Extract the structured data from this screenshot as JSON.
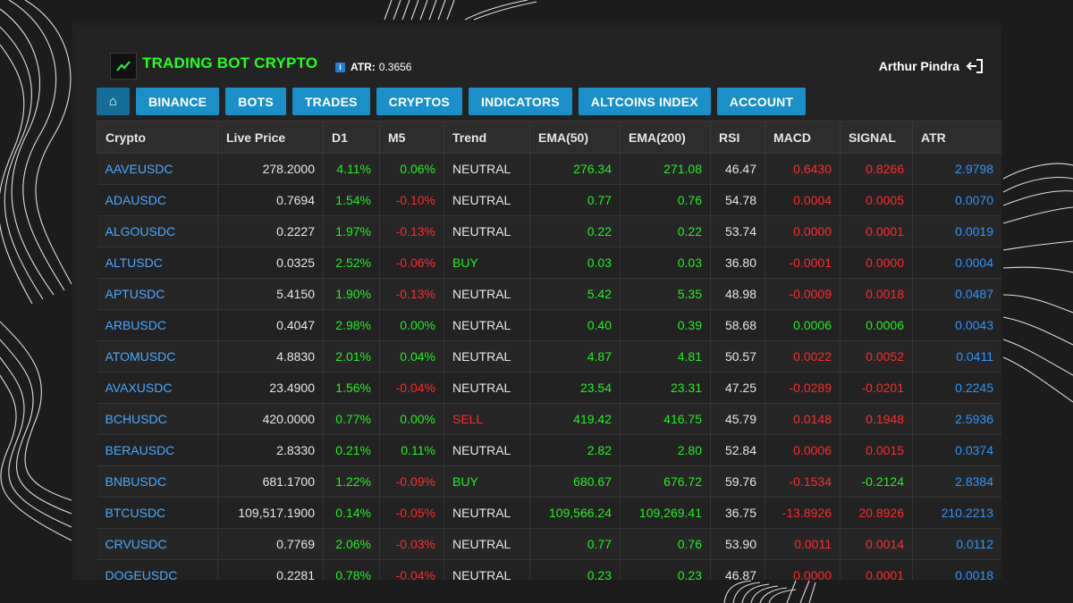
{
  "app": {
    "title": "TRADING BOT CRYPTO",
    "atr_label": "ATR:",
    "atr_value": "0.3656",
    "user_name": "Arthur Pindra"
  },
  "nav": {
    "home": "⌂",
    "items": [
      "BINANCE",
      "BOTS",
      "TRADES",
      "CRYPTOS",
      "INDICATORS",
      "ALTCOINS INDEX",
      "ACCOUNT"
    ]
  },
  "colors": {
    "accent": "#1b8fc7",
    "title": "#22ff22",
    "positive": "#22ee22",
    "negative": "#ff2a2a",
    "link": "#4aa8ff"
  },
  "table": {
    "headers": [
      "Crypto",
      "Live Price",
      "D1",
      "M5",
      "Trend",
      "EMA(50)",
      "EMA(200)",
      "RSI",
      "MACD",
      "SIGNAL",
      "ATR"
    ],
    "rows": [
      {
        "crypto": "AAVEUSDC",
        "price": "278.2000",
        "d1": "4.11%",
        "m5": "0.06%",
        "trend": "NEUTRAL",
        "ema50": "276.34",
        "ema200": "271.08",
        "rsi": "46.47",
        "macd": "0.6430",
        "signal": "0.8266",
        "atr": "2.9798"
      },
      {
        "crypto": "ADAUSDC",
        "price": "0.7694",
        "d1": "1.54%",
        "m5": "-0.10%",
        "trend": "NEUTRAL",
        "ema50": "0.77",
        "ema200": "0.76",
        "rsi": "54.78",
        "macd": "0.0004",
        "signal": "0.0005",
        "atr": "0.0070"
      },
      {
        "crypto": "ALGOUSDC",
        "price": "0.2227",
        "d1": "1.97%",
        "m5": "-0.13%",
        "trend": "NEUTRAL",
        "ema50": "0.22",
        "ema200": "0.22",
        "rsi": "53.74",
        "macd": "0.0000",
        "signal": "0.0001",
        "atr": "0.0019"
      },
      {
        "crypto": "ALTUSDC",
        "price": "0.0325",
        "d1": "2.52%",
        "m5": "-0.06%",
        "trend": "BUY",
        "ema50": "0.03",
        "ema200": "0.03",
        "rsi": "36.80",
        "macd": "-0.0001",
        "signal": "0.0000",
        "atr": "0.0004"
      },
      {
        "crypto": "APTUSDC",
        "price": "5.4150",
        "d1": "1.90%",
        "m5": "-0.13%",
        "trend": "NEUTRAL",
        "ema50": "5.42",
        "ema200": "5.35",
        "rsi": "48.98",
        "macd": "-0.0009",
        "signal": "0.0018",
        "atr": "0.0487"
      },
      {
        "crypto": "ARBUSDC",
        "price": "0.4047",
        "d1": "2.98%",
        "m5": "0.00%",
        "trend": "NEUTRAL",
        "ema50": "0.40",
        "ema200": "0.39",
        "rsi": "58.68",
        "macd": "0.0006",
        "signal": "0.0006",
        "atr": "0.0043"
      },
      {
        "crypto": "ATOMUSDC",
        "price": "4.8830",
        "d1": "2.01%",
        "m5": "0.04%",
        "trend": "NEUTRAL",
        "ema50": "4.87",
        "ema200": "4.81",
        "rsi": "50.57",
        "macd": "0.0022",
        "signal": "0.0052",
        "atr": "0.0411"
      },
      {
        "crypto": "AVAXUSDC",
        "price": "23.4900",
        "d1": "1.56%",
        "m5": "-0.04%",
        "trend": "NEUTRAL",
        "ema50": "23.54",
        "ema200": "23.31",
        "rsi": "47.25",
        "macd": "-0.0289",
        "signal": "-0.0201",
        "atr": "0.2245"
      },
      {
        "crypto": "BCHUSDC",
        "price": "420.0000",
        "d1": "0.77%",
        "m5": "0.00%",
        "trend": "SELL",
        "ema50": "419.42",
        "ema200": "416.75",
        "rsi": "45.79",
        "macd": "0.0148",
        "signal": "0.1948",
        "atr": "2.5936"
      },
      {
        "crypto": "BERAUSDC",
        "price": "2.8330",
        "d1": "0.21%",
        "m5": "0.11%",
        "trend": "NEUTRAL",
        "ema50": "2.82",
        "ema200": "2.80",
        "rsi": "52.84",
        "macd": "0.0006",
        "signal": "0.0015",
        "atr": "0.0374"
      },
      {
        "crypto": "BNBUSDC",
        "price": "681.1700",
        "d1": "1.22%",
        "m5": "-0.09%",
        "trend": "BUY",
        "ema50": "680.67",
        "ema200": "676.72",
        "rsi": "59.76",
        "macd": "-0.1534",
        "signal": "-0.2124",
        "atr": "2.8384"
      },
      {
        "crypto": "BTCUSDC",
        "price": "109,517.1900",
        "d1": "0.14%",
        "m5": "-0.05%",
        "trend": "NEUTRAL",
        "ema50": "109,566.24",
        "ema200": "109,269.41",
        "rsi": "36.75",
        "macd": "-13.8926",
        "signal": "20.8926",
        "atr": "210.2213"
      },
      {
        "crypto": "CRVUSDC",
        "price": "0.7769",
        "d1": "2.06%",
        "m5": "-0.03%",
        "trend": "NEUTRAL",
        "ema50": "0.77",
        "ema200": "0.76",
        "rsi": "53.90",
        "macd": "0.0011",
        "signal": "0.0014",
        "atr": "0.0112"
      },
      {
        "crypto": "DOGEUSDC",
        "price": "0.2281",
        "d1": "0.78%",
        "m5": "-0.04%",
        "trend": "NEUTRAL",
        "ema50": "0.23",
        "ema200": "0.23",
        "rsi": "46.87",
        "macd": "0.0000",
        "signal": "0.0001",
        "atr": "0.0018"
      }
    ]
  }
}
